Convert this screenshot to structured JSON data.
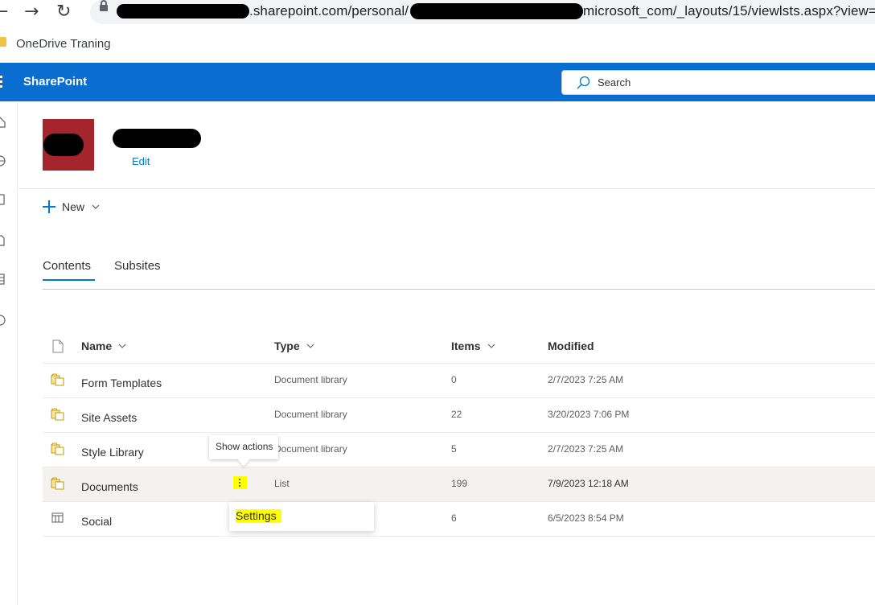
{
  "browser": {
    "url_visible": ".sharepoint.com/personal/",
    "url_tail": "microsoft_com/_layouts/15/viewlsts.aspx?view=",
    "bookmark": "OneDrive Traning"
  },
  "suitebar": {
    "brand": "SharePoint",
    "search_placeholder": "Search",
    "accent_color": "#0a6ed1"
  },
  "site": {
    "edit_label": "Edit",
    "logo_color": "#a4262c"
  },
  "command_bar": {
    "new_label": "New"
  },
  "tabs": [
    {
      "label": "Contents",
      "active": true
    },
    {
      "label": "Subsites",
      "active": false
    }
  ],
  "table": {
    "columns": {
      "name": "Name",
      "type": "Type",
      "items": "Items",
      "modified": "Modified"
    },
    "rows": [
      {
        "name": "Form Templates",
        "type": "Document library",
        "items": "0",
        "modified": "2/7/2023 7:25 AM",
        "icon": "library-icon"
      },
      {
        "name": "Site Assets",
        "type": "Document library",
        "items": "22",
        "modified": "3/20/2023 7:06 PM",
        "icon": "library-icon"
      },
      {
        "name": "Style Library",
        "type": "Document library",
        "items": "5",
        "modified": "2/7/2023 7:25 AM",
        "icon": "library-icon"
      },
      {
        "name": "Documents",
        "type": "List",
        "items": "199",
        "modified": "7/9/2023 12:18 AM",
        "icon": "library-icon",
        "selected": true
      },
      {
        "name": "Social",
        "type": "",
        "items": "6",
        "modified": "6/5/2023 8:54 PM",
        "icon": "list-icon"
      }
    ]
  },
  "tooltip": {
    "text": "Show actions"
  },
  "context_menu": {
    "settings_label": "Settings"
  },
  "highlight_color": "#ffff00"
}
